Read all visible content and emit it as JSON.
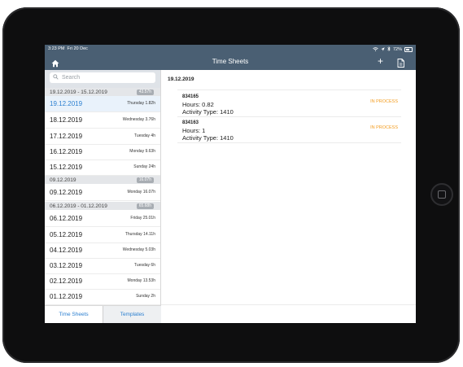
{
  "status_bar": {
    "time": "3:23 PM",
    "date": "Fri 20 Dec",
    "battery": "72%"
  },
  "nav": {
    "title": "Time Sheets",
    "add_label": "+"
  },
  "search": {
    "placeholder": "Search"
  },
  "sidebar": {
    "groups": [
      {
        "label": "19.12.2019 - 15.12.2019",
        "badge": "43.57h",
        "items": [
          {
            "date": "19.12.2019",
            "summary": "Thursday 1.82h",
            "selected": true
          },
          {
            "date": "18.12.2019",
            "summary": "Wednesday 3.76h"
          },
          {
            "date": "17.12.2019",
            "summary": "Tuesday 4h"
          },
          {
            "date": "16.12.2019",
            "summary": "Monday 9.63h"
          },
          {
            "date": "15.12.2019",
            "summary": "Sunday 24h"
          }
        ]
      },
      {
        "label": "09.12.2019",
        "badge": "16.07h",
        "items": [
          {
            "date": "09.12.2019",
            "summary": "Monday 16.07h"
          }
        ]
      },
      {
        "label": "06.12.2019 - 01.12.2019",
        "badge": "65.68h",
        "items": [
          {
            "date": "06.12.2019",
            "summary": "Friday 25.01h"
          },
          {
            "date": "05.12.2019",
            "summary": "Thursday 14.11h"
          },
          {
            "date": "04.12.2019",
            "summary": "Wednesday 5.03h"
          },
          {
            "date": "03.12.2019",
            "summary": "Tuesday 6h"
          },
          {
            "date": "02.12.2019",
            "summary": "Monday 13.53h"
          },
          {
            "date": "01.12.2019",
            "summary": "Sunday 2h"
          }
        ]
      }
    ]
  },
  "tabs": [
    {
      "label": "Time Sheets",
      "active": false
    },
    {
      "label": "Templates",
      "active": true
    }
  ],
  "detail": {
    "header": "19.12.2019",
    "entries": [
      {
        "id": "834165",
        "hours": "Hours: 0.82",
        "activity": "Activity Type: 1410",
        "status": "IN PROCESS"
      },
      {
        "id": "834163",
        "hours": "Hours: 1",
        "activity": "Activity Type: 1410",
        "status": "IN PROCESS"
      }
    ]
  },
  "colors": {
    "nav_bg": "#4a5f73",
    "accent": "#2b7fd0",
    "status_orange": "#f39c1e"
  },
  "icons": {
    "home": "home-icon",
    "add": "plus-icon",
    "document": "document-icon",
    "search": "search-icon"
  }
}
